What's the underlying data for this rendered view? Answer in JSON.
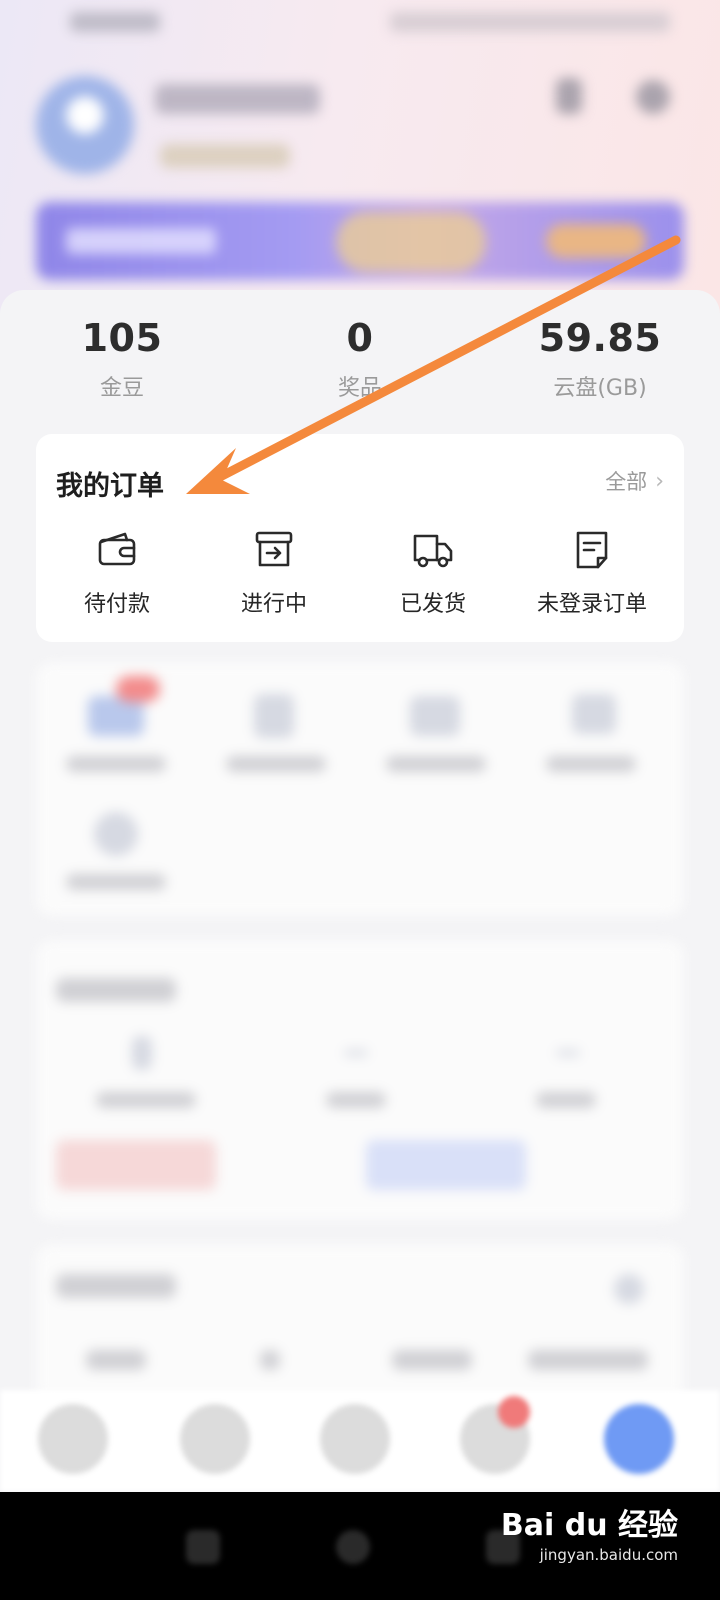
{
  "stats": [
    {
      "value": "105",
      "label": "金豆"
    },
    {
      "value": "0",
      "label": "奖品"
    },
    {
      "value": "59.85",
      "label": "云盘(GB)"
    }
  ],
  "orders": {
    "title": "我的订单",
    "all_label": "全部",
    "items": [
      {
        "label": "待付款",
        "icon": "wallet-icon"
      },
      {
        "label": "进行中",
        "icon": "box-arrow-icon"
      },
      {
        "label": "已发货",
        "icon": "truck-icon"
      },
      {
        "label": "未登录订单",
        "icon": "document-icon"
      }
    ]
  },
  "watermark": {
    "brand": "Bai du 经验",
    "url": "jingyan.baidu.com"
  },
  "colors": {
    "arrow": "#f4893c",
    "banner": "#9b90ec",
    "accent_blue": "#5b8cf5"
  }
}
